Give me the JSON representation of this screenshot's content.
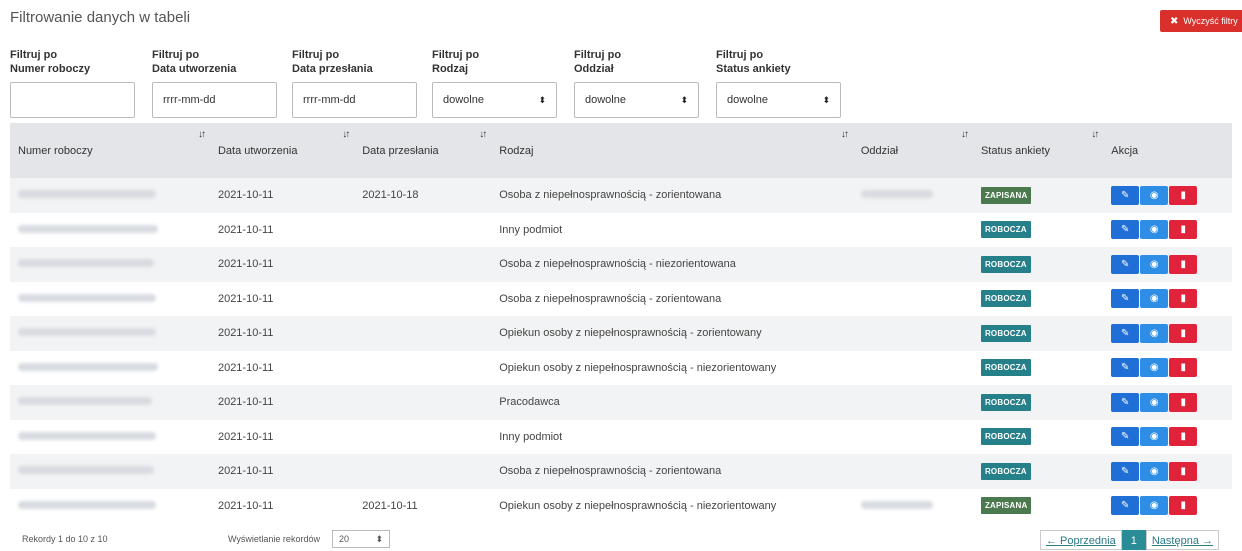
{
  "header": {
    "title": "Filtrowanie danych w tabeli",
    "clear_filters": "Wyczyść filtry",
    "clear_icon": "✖"
  },
  "filters": [
    {
      "line1": "Filtruj po",
      "line2": "Numer roboczy",
      "value": "",
      "type": "text"
    },
    {
      "line1": "Filtruj po",
      "line2": "Data utworzenia",
      "value": "rrrr-mm-dd",
      "type": "text"
    },
    {
      "line1": "Filtruj po",
      "line2": "Data przesłania",
      "value": "rrrr-mm-dd",
      "type": "text"
    },
    {
      "line1": "Filtruj po",
      "line2": "Rodzaj",
      "value": "dowolne",
      "type": "select"
    },
    {
      "line1": "Filtruj po",
      "line2": "Oddział",
      "value": "dowolne",
      "type": "select"
    },
    {
      "line1": "Filtruj po",
      "line2": "Status ankiety",
      "value": "dowolne",
      "type": "select"
    }
  ],
  "table": {
    "sort_icon": "↓↑",
    "columns": [
      "Numer roboczy",
      "Data utworzenia",
      "Data przesłania",
      "Rodzaj",
      "Oddział",
      "Status ankiety",
      "Akcja"
    ],
    "rows": [
      {
        "created": "2021-10-11",
        "sent": "2021-10-18",
        "type": "Osoba z niepełnosprawnością - zorientowana",
        "branch_blurred": true,
        "status": "ZAPISANA"
      },
      {
        "created": "2021-10-11",
        "sent": "",
        "type": "Inny podmiot",
        "branch_blurred": false,
        "status": "ROBOCZA"
      },
      {
        "created": "2021-10-11",
        "sent": "",
        "type": "Osoba z niepełnosprawnością - niezorientowana",
        "branch_blurred": false,
        "status": "ROBOCZA"
      },
      {
        "created": "2021-10-11",
        "sent": "",
        "type": "Osoba z niepełnosprawnością - zorientowana",
        "branch_blurred": false,
        "status": "ROBOCZA"
      },
      {
        "created": "2021-10-11",
        "sent": "",
        "type": "Opiekun osoby z niepełnosprawnością - zorientowany",
        "branch_blurred": false,
        "status": "ROBOCZA"
      },
      {
        "created": "2021-10-11",
        "sent": "",
        "type": "Opiekun osoby z niepełnosprawnością - niezorientowany",
        "branch_blurred": false,
        "status": "ROBOCZA"
      },
      {
        "created": "2021-10-11",
        "sent": "",
        "type": "Pracodawca",
        "branch_blurred": false,
        "status": "ROBOCZA"
      },
      {
        "created": "2021-10-11",
        "sent": "",
        "type": "Inny podmiot",
        "branch_blurred": false,
        "status": "ROBOCZA"
      },
      {
        "created": "2021-10-11",
        "sent": "",
        "type": "Osoba z niepełnosprawnością - zorientowana",
        "branch_blurred": false,
        "status": "ROBOCZA"
      },
      {
        "created": "2021-10-11",
        "sent": "2021-10-11",
        "type": "Opiekun osoby z niepełnosprawnością - niezorientowany",
        "branch_blurred": true,
        "status": "ZAPISANA"
      }
    ],
    "actions": [
      {
        "name": "edit-icon",
        "glyph": "✎",
        "color": "#1f6fd6"
      },
      {
        "name": "eye-icon",
        "glyph": "◉",
        "color": "#2e8ee6"
      },
      {
        "name": "trash-icon",
        "glyph": "▮",
        "color": "#e0233a"
      }
    ]
  },
  "status_colors": {
    "ZAPISANA": "#4a7a4d",
    "ROBOCZA": "#26808a"
  },
  "footer": {
    "records": "Rekordy 1 do 10 z 10",
    "show_label": "Wyświetlanie rekordów",
    "page_size": "20",
    "prev": "← Poprzednia",
    "current": "1",
    "next": "Następna →"
  }
}
